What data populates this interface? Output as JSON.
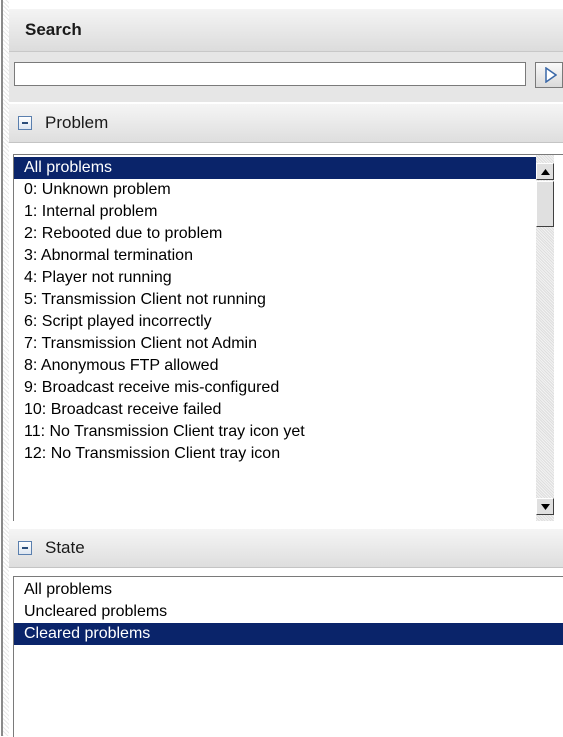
{
  "search": {
    "title": "Search",
    "input_value": "",
    "placeholder": "",
    "go_icon": "play-triangle-icon"
  },
  "problem": {
    "title": "Problem",
    "collapse_icon": "minus-box-icon",
    "selected_index": 0,
    "items": [
      "All problems",
      "0: Unknown problem",
      "1: Internal problem",
      "2: Rebooted due to problem",
      "3: Abnormal termination",
      "4: Player not running",
      "5: Transmission Client not running",
      "6: Script played incorrectly",
      "7: Transmission Client not Admin",
      "8: Anonymous FTP allowed",
      "9: Broadcast receive mis-configured",
      "10: Broadcast receive failed",
      "11: No Transmission Client tray icon yet",
      "12: No Transmission Client tray icon"
    ]
  },
  "state": {
    "title": "State",
    "collapse_icon": "minus-box-icon",
    "selected_index": 2,
    "items": [
      "All problems",
      "Uncleared problems",
      "Cleared problems"
    ]
  },
  "colors": {
    "selection_background": "#0a246a",
    "selection_text": "#ffffff",
    "header_background": "#e0e0e0"
  }
}
